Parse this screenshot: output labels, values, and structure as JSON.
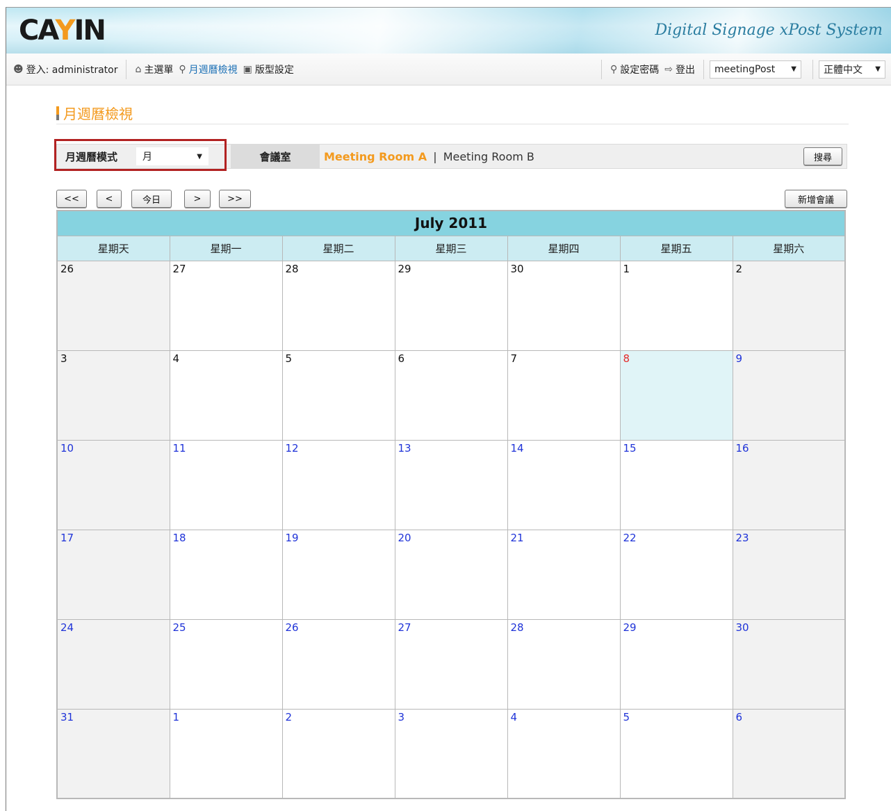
{
  "header": {
    "logo_text": "CAYIN",
    "system_title": "Digital Signage xPost System"
  },
  "toolbar": {
    "user_label": "登入: administrator",
    "main_menu": "主選單",
    "calendar_view": "月週曆檢視",
    "layout_settings": "版型設定",
    "set_password": "設定密碼",
    "logout": "登出",
    "account_select": "meetingPost",
    "language_select": "正體中文"
  },
  "page": {
    "title": "月週曆檢視"
  },
  "filter": {
    "mode_label": "月週曆模式",
    "mode_value": "月",
    "room_label": "會議室",
    "room_active": "Meeting Room A",
    "room_separator": "|",
    "room_other": "Meeting Room B",
    "search_button": "搜尋"
  },
  "nav": {
    "first": "<<",
    "prev": "<",
    "today": "今日",
    "next": ">",
    "last": ">>",
    "add_meeting": "新增會議"
  },
  "calendar": {
    "month_title": "July 2011",
    "weekdays": [
      "星期天",
      "星期一",
      "星期二",
      "星期三",
      "星期四",
      "星期五",
      "星期六"
    ],
    "weeks": [
      [
        "26",
        "27",
        "28",
        "29",
        "30",
        "1",
        "2"
      ],
      [
        "3",
        "4",
        "5",
        "6",
        "7",
        "8",
        "9"
      ],
      [
        "10",
        "11",
        "12",
        "13",
        "14",
        "15",
        "16"
      ],
      [
        "17",
        "18",
        "19",
        "20",
        "21",
        "22",
        "23"
      ],
      [
        "24",
        "25",
        "26",
        "27",
        "28",
        "29",
        "30"
      ],
      [
        "31",
        "1",
        "2",
        "3",
        "4",
        "5",
        "6"
      ]
    ],
    "today": "8"
  },
  "colors": {
    "accent_orange": "#f39a1e",
    "header_cyan": "#86d3e0",
    "weekday_cyan": "#ccecf2",
    "today_cell": "#e0f4f7",
    "future_blue": "#1f33d8",
    "today_red": "#e52a2a",
    "highlight_red_border": "#b22222"
  }
}
